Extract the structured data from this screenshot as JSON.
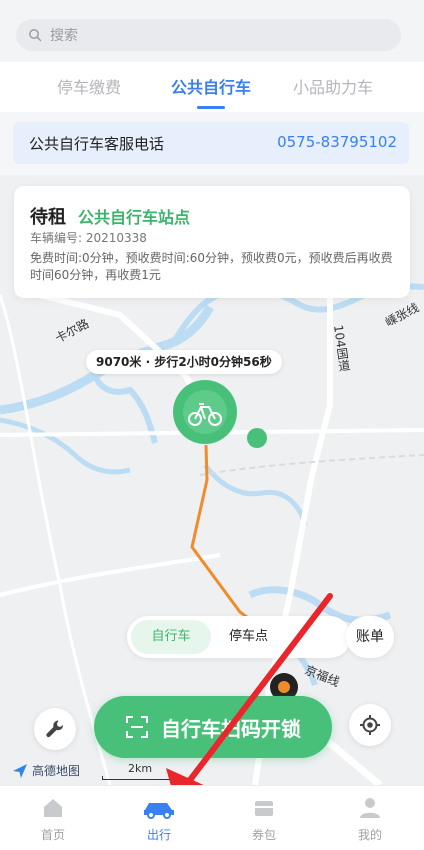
{
  "search": {
    "placeholder": "搜索"
  },
  "tabs": [
    {
      "label": "停车缴费"
    },
    {
      "label": "公共自行车"
    },
    {
      "label": "小品助力车"
    }
  ],
  "hotline": {
    "label": "公共自行车客服电话",
    "number": "0575-83795102"
  },
  "bike_card": {
    "status": "待租",
    "station": "公共自行车站点",
    "vehicle_no": "车辆编号: 20210338",
    "rules": "免费时间:0分钟，预收费时间:60分钟，预收费0元，预收费后再收费时间60分钟，再收费1元"
  },
  "map": {
    "distance": "9070米 · 步行2小时0分钟56秒",
    "labels": {
      "road1": "卡尔路",
      "road2": "104国道",
      "road3": "京福线",
      "road4": "嵊张线"
    },
    "provider": "高德地图",
    "scale": "2km"
  },
  "mode_toggle": {
    "bike": "自行车",
    "parking": "停车点",
    "ledger": "账单"
  },
  "scan_button": {
    "label": "自行车扫码开锁"
  },
  "bottom_nav": [
    {
      "label": "首页",
      "icon": "home-icon"
    },
    {
      "label": "出行",
      "icon": "car-icon",
      "active": true
    },
    {
      "label": "券包",
      "icon": "wallet-icon"
    },
    {
      "label": "我的",
      "icon": "user-icon"
    }
  ],
  "colors": {
    "accent": "#3a7ff3",
    "green": "#49c07a",
    "route": "#f08c2a",
    "arrow": "#e8262c"
  }
}
